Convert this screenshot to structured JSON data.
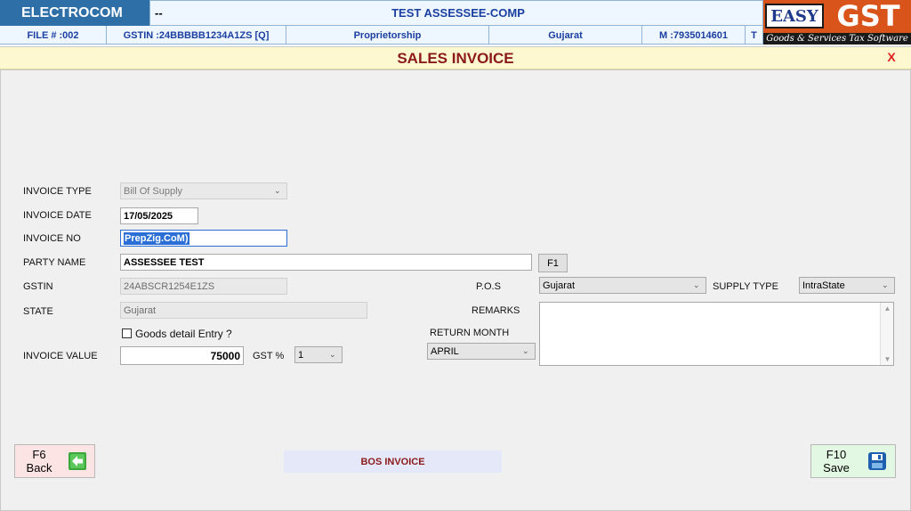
{
  "header": {
    "company": "ELECTROCOM",
    "dash": "--",
    "assessee": "TEST ASSESSEE-COMP",
    "file_no": "FILE # :002",
    "gstin": "GSTIN :24BBBBB1234A1ZS [Q]",
    "business_type": "Proprietorship",
    "state": "Gujarat",
    "mobile": "M :7935014601",
    "extra": "T"
  },
  "logo": {
    "easy": "EASY",
    "gst": "GST",
    "tagline": "Goods & Services Tax Software"
  },
  "title": "SALES INVOICE",
  "close_label": "X",
  "form": {
    "invoice_type_label": "INVOICE TYPE",
    "invoice_type_value": "Bill Of Supply",
    "invoice_date_label": "INVOICE DATE",
    "invoice_date_value": "17/05/2025",
    "invoice_no_label": "INVOICE NO",
    "invoice_no_value": "PrepZig.CoM)",
    "party_name_label": "PARTY NAME",
    "party_name_value": "ASSESSEE TEST",
    "f1_label": "F1",
    "gstin_label": "GSTIN",
    "gstin_value": "24ABSCR1254E1ZS",
    "pos_label": "P.O.S",
    "pos_value": "Gujarat",
    "supply_type_label": "SUPPLY TYPE",
    "supply_type_value": "IntraState",
    "state_label": "STATE",
    "state_value": "Gujarat",
    "remarks_label": "REMARKS",
    "goods_detail_label": "Goods detail Entry ?",
    "return_month_label": "RETURN MONTH",
    "return_month_value": "APRIL",
    "invoice_value_label": "INVOICE VALUE",
    "invoice_value_value": "75000",
    "gst_pct_label": "GST %",
    "gst_pct_value": "1"
  },
  "footer": {
    "back_key": "F6",
    "back_label": "Back",
    "bos_label": "BOS INVOICE",
    "save_key": "F10",
    "save_label": "Save"
  },
  "colors": {
    "header_blue": "#2f6fa8",
    "title_red": "#8b1a1a",
    "logo_orange": "#d9541a",
    "selection_blue": "#2b6fd6"
  }
}
